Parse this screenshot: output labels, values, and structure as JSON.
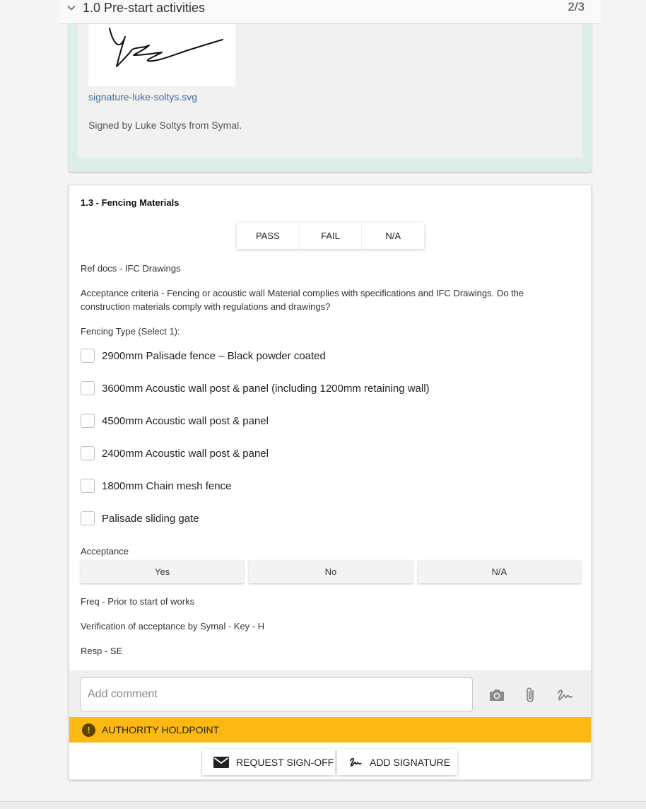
{
  "section": {
    "title": "1.0 Pre-start activities",
    "count": "2/3"
  },
  "signature": {
    "filename": "signature-luke-soltys.svg",
    "signed_by": "Signed by Luke Soltys from Symal."
  },
  "item": {
    "title": "1.3 - Fencing Materials",
    "result_options": [
      "PASS",
      "FAIL",
      "N/A"
    ],
    "ref_docs": "Ref docs - IFC Drawings",
    "acceptance_criteria": "Acceptance criteria - Fencing or acoustic wall Material complies with specifications and IFC Drawings. Do the construction materials comply with regulations and drawings?",
    "fencing_type_label": "Fencing Type (Select 1):",
    "fencing_options": [
      "2900mm Palisade fence – Black powder coated",
      "3600mm Acoustic wall post & panel (including 1200mm retaining wall)",
      "4500mm Acoustic wall post & panel",
      "2400mm Acoustic wall post & panel",
      "1800mm Chain mesh fence",
      "Palisade sliding gate"
    ],
    "acceptance_label": "Acceptance",
    "acceptance_options": [
      "Yes",
      "No",
      "N/A"
    ],
    "freq": "Freq - Prior to start of works",
    "verification": "Verification of acceptance by Symal - Key - H",
    "resp": "Resp - SE"
  },
  "comment": {
    "placeholder": "Add comment"
  },
  "holdpoint": {
    "label": "AUTHORITY HOLDPOINT"
  },
  "actions": {
    "request_signoff": "REQUEST SIGN-OFF",
    "add_signature": "ADD SIGNATURE"
  },
  "icons": {
    "chevron": "chevron-down-icon",
    "camera": "camera-icon",
    "attach": "paperclip-icon",
    "signature": "signature-icon",
    "warning": "warning-icon",
    "mail": "mail-icon"
  },
  "colors": {
    "holdpoint": "#fdb913",
    "signed_bg": "#dcefe6",
    "link": "#3b6ea5"
  }
}
